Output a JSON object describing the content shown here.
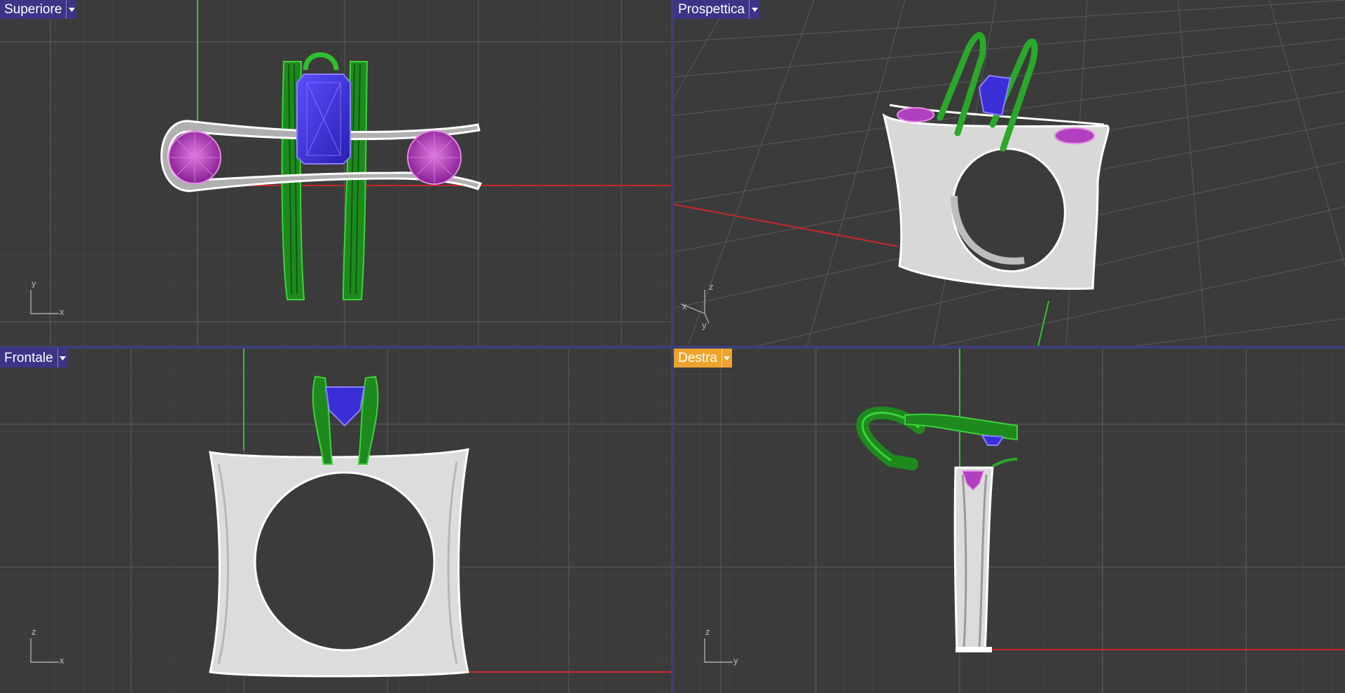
{
  "viewports": [
    {
      "id": "top",
      "label": "Superiore",
      "active": false,
      "axes": {
        "vertical": "y",
        "horizontal": "x"
      }
    },
    {
      "id": "persp",
      "label": "Prospettica",
      "active": false,
      "axes": {
        "a": "z",
        "b": "x",
        "c": "y"
      }
    },
    {
      "id": "front",
      "label": "Frontale",
      "active": false,
      "axes": {
        "vertical": "z",
        "horizontal": "x"
      }
    },
    {
      "id": "right",
      "label": "Destra",
      "active": true,
      "axes": {
        "vertical": "z",
        "horizontal": "y"
      }
    }
  ],
  "colors": {
    "viewport_bg": "#3b3b3b",
    "grid_minor": "#4a4a4a",
    "grid_major": "#5c5c5c",
    "x_axis": "#c8282b",
    "y_axis": "#2fc22f",
    "metal": "#e4e4e4",
    "prongs": "#1f8a1f",
    "center_stone": "#3a2fd6",
    "side_stones": "#b040c0",
    "active_tab": "#f0a32c",
    "inactive_tab": "#3c3486"
  },
  "icons": {
    "dropdown": "chevron-down-icon",
    "axis": "axis-triad-icon"
  }
}
